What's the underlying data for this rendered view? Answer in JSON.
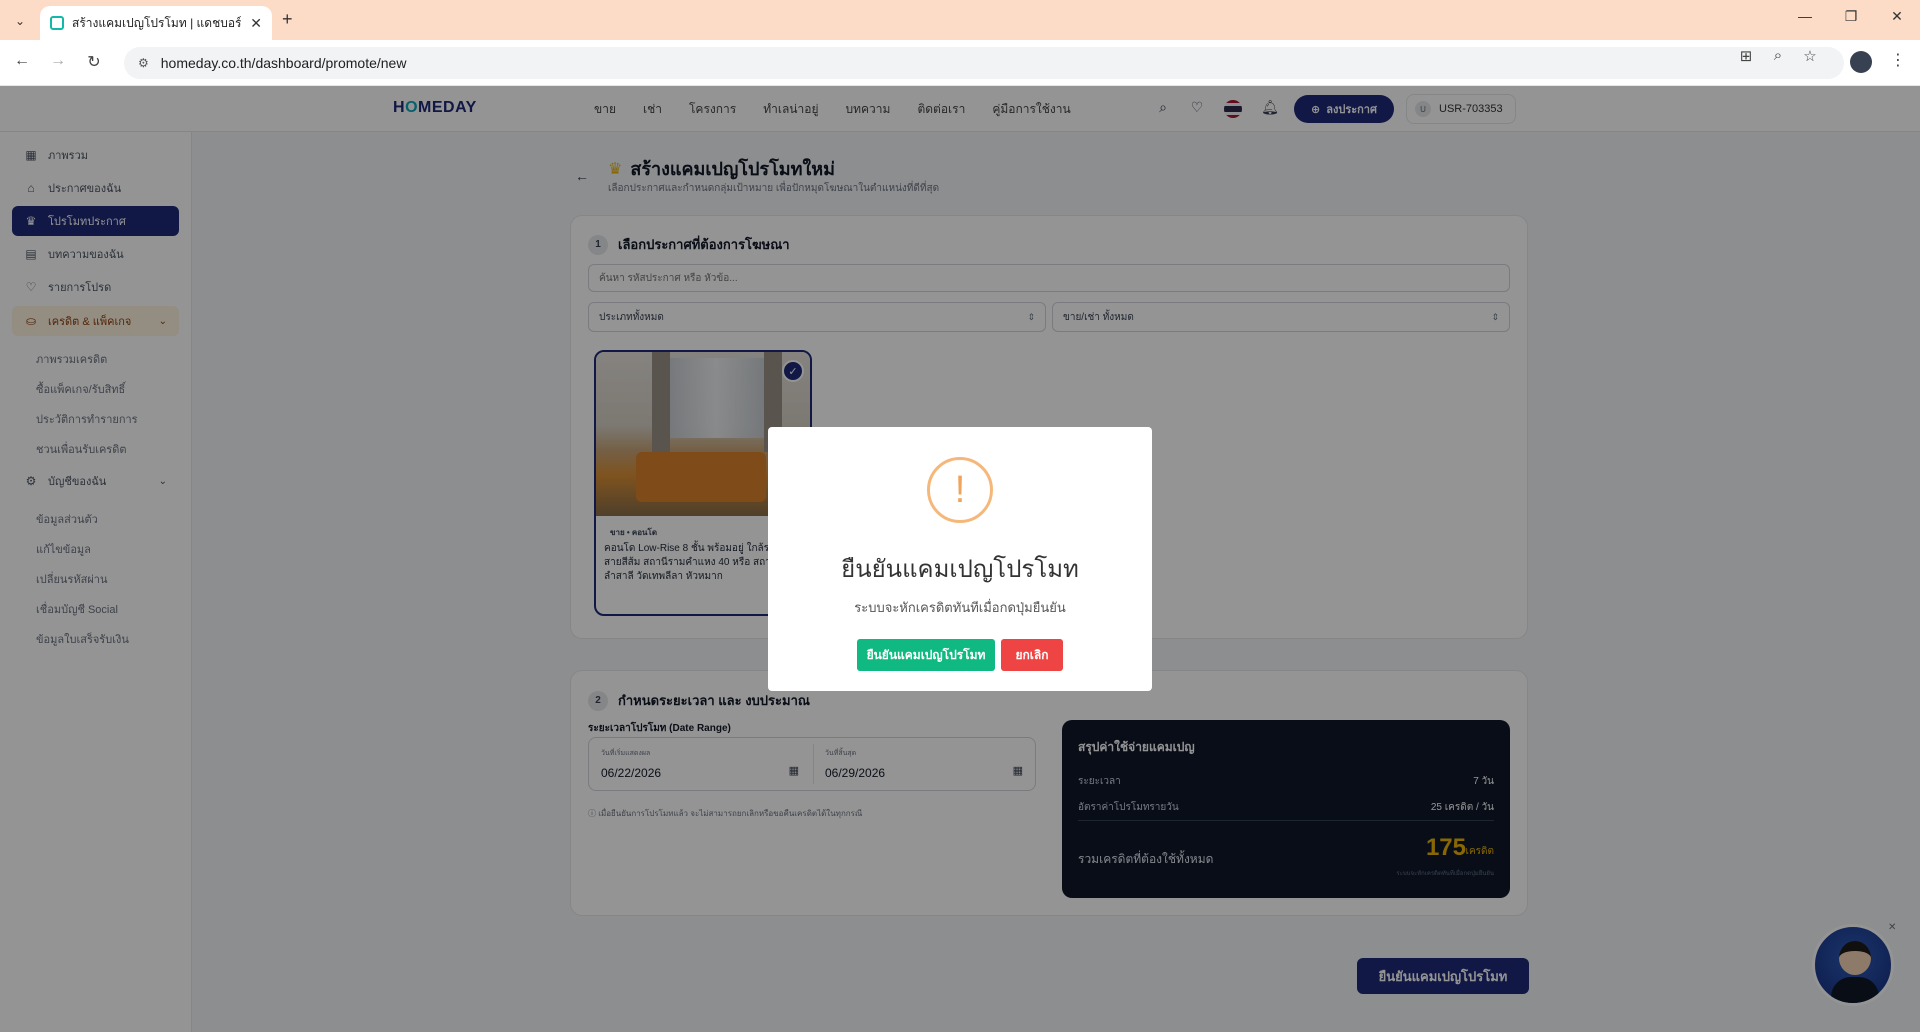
{
  "browser": {
    "tab_title": "สร้างแคมเปญโปรโมท | แดชบอร์ด",
    "url": "homeday.co.th/dashboard/promote/new"
  },
  "header": {
    "logo_a": "H",
    "logo_b": "O",
    "logo_c": "MEDAY",
    "nav": [
      "ขาย",
      "เช่า",
      "โครงการ",
      "ทำเลน่าอยู่",
      "บทความ",
      "ติดต่อเรา",
      "คู่มือการใช้งาน"
    ],
    "post_button": "ลงประกาศ",
    "user_avatar": "U",
    "user_id": "USR-703353"
  },
  "sidebar": {
    "items": [
      {
        "label": "ภาพรวม",
        "icon": "grid-icon"
      },
      {
        "label": "ประกาศของฉัน",
        "icon": "home-icon"
      },
      {
        "label": "โปรโมทประกาศ",
        "icon": "crown-icon"
      },
      {
        "label": "บทความของฉัน",
        "icon": "document-icon"
      },
      {
        "label": "รายการโปรด",
        "icon": "heart-icon"
      }
    ],
    "credit_group": "เครดิต & แพ็คเกจ",
    "credit_sub": [
      "ภาพรวมเครดิต",
      "ซื้อแพ็คเกจ/รับสิทธิ์",
      "ประวัติการทำรายการ",
      "ชวนเพื่อนรับเครดิต"
    ],
    "account_group": "บัญชีของฉัน",
    "account_sub": [
      "ข้อมูลส่วนตัว",
      "แก้ไขข้อมูล",
      "เปลี่ยนรหัสผ่าน",
      "เชื่อมบัญชี Social",
      "ข้อมูลใบเสร็จรับเงิน"
    ]
  },
  "page": {
    "title": "สร้างแคมเปญโปรโมทใหม่",
    "subtitle": "เลือกประกาศและกำหนดกลุ่มเป้าหมาย เพื่อปักหมุดโฆษณาในตำแหน่งที่ดีที่สุด"
  },
  "step1": {
    "num": "1",
    "title": "เลือกประกาศที่ต้องการโฆษณา",
    "search_placeholder": "ค้นหา รหัสประกาศ หรือ หัวข้อ...",
    "filter_type": "ประเภททั้งหมด",
    "filter_deal": "ขาย/เช่า ทั้งหมด",
    "listing_tag": "ขาย • คอนโด",
    "listing_title": "คอนโด Low-Rise 8 ชั้น พร้อมอยู่ ใกล้รถไฟฟ้า สายสีส้ม สถานีรามคำแหง 40 หรือ สถานีลำสาลี วัดเทพลีลา หัวหมาก"
  },
  "step2": {
    "num": "2",
    "title": "กำหนดระยะเวลา และ งบประมาณ",
    "range_label": "ระยะเวลาโปรโมท (Date Range)",
    "start_label": "วันที่เริ่มแสดงผล",
    "start_value": "06/22/2026",
    "end_label": "วันที่สิ้นสุด",
    "end_value": "06/29/2026",
    "note": "ⓘ เมื่อยืนยันการโปรโมทแล้ว จะไม่สามารถยกเลิกหรือขอคืนเครดิตได้ในทุกกรณี"
  },
  "summary": {
    "title": "สรุปค่าใช้จ่ายแคมเปญ",
    "duration_label": "ระยะเวลา",
    "duration_value": "7 วัน",
    "rate_label": "อัตราค่าโปรโมทรายวัน",
    "rate_value": "25 เครดิต / วัน",
    "total_label": "รวมเครดิตที่ต้องใช้ทั้งหมด",
    "total_value": "175",
    "total_unit": "เครดิต",
    "footnote": "ระบบจะหักเครดิตทันทีเมื่อกดปุ่มยืนยัน"
  },
  "confirm_button": "ยืนยันแคมเปญโปรโมท",
  "modal": {
    "title": "ยืนยันแคมเปญโปรโมท",
    "text": "ระบบจะหักเครดิตทันทีเมื่อกดปุ่มยืนยัน",
    "ok": "ยืนยันแคมเปญโปรโมท",
    "cancel": "ยกเลิก"
  }
}
